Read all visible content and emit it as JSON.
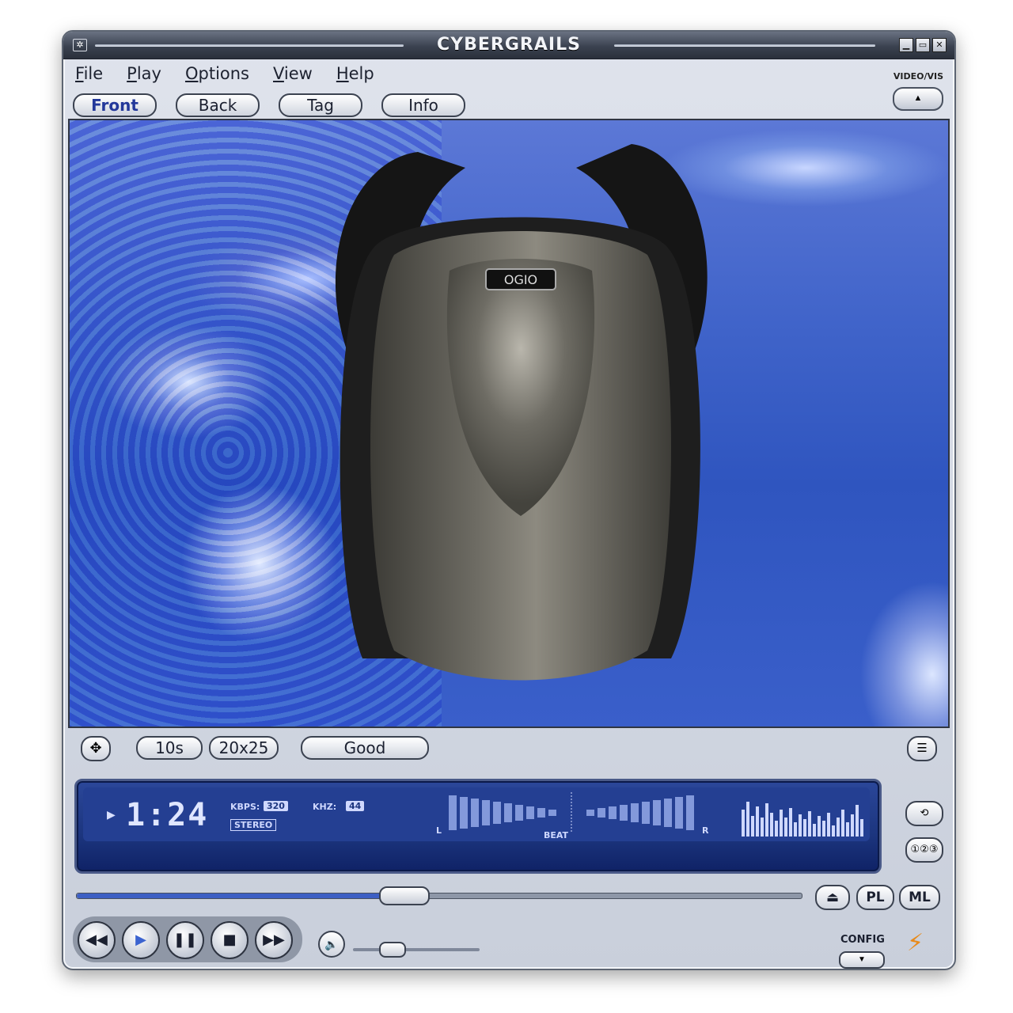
{
  "window": {
    "title": "CYBERGRAILS"
  },
  "menu": {
    "items": [
      {
        "label": "File",
        "hotkey": "F"
      },
      {
        "label": "Play",
        "hotkey": "P"
      },
      {
        "label": "Options",
        "hotkey": "O"
      },
      {
        "label": "View",
        "hotkey": "V"
      },
      {
        "label": "Help",
        "hotkey": "H"
      }
    ]
  },
  "videovis": {
    "label": "VIDEO/VIS"
  },
  "tabs": [
    {
      "label": "Front",
      "active": true
    },
    {
      "label": "Back",
      "active": false
    },
    {
      "label": "Tag",
      "active": false
    },
    {
      "label": "Info",
      "active": false
    }
  ],
  "video": {
    "logo_text": "OGIO"
  },
  "controls": {
    "duration": "10s",
    "size": "20x25",
    "condition": "Good"
  },
  "display": {
    "time": "1:24",
    "kbps_label": "KBPS:",
    "kbps": "320",
    "khz_label": "KHZ:",
    "khz": "44",
    "stereo": "STEREO",
    "left": "L",
    "right": "R",
    "beat": "BEAT"
  },
  "seek": {
    "progress": 0.45
  },
  "buttons": {
    "pl": "PL",
    "ml": "ML"
  },
  "volume": {
    "level": 0.3
  },
  "config": {
    "label": "CONFIG"
  },
  "colors": {
    "accent": "#3b63d0",
    "display_bg": "#1c357e",
    "bolt": "#e88a1a"
  }
}
